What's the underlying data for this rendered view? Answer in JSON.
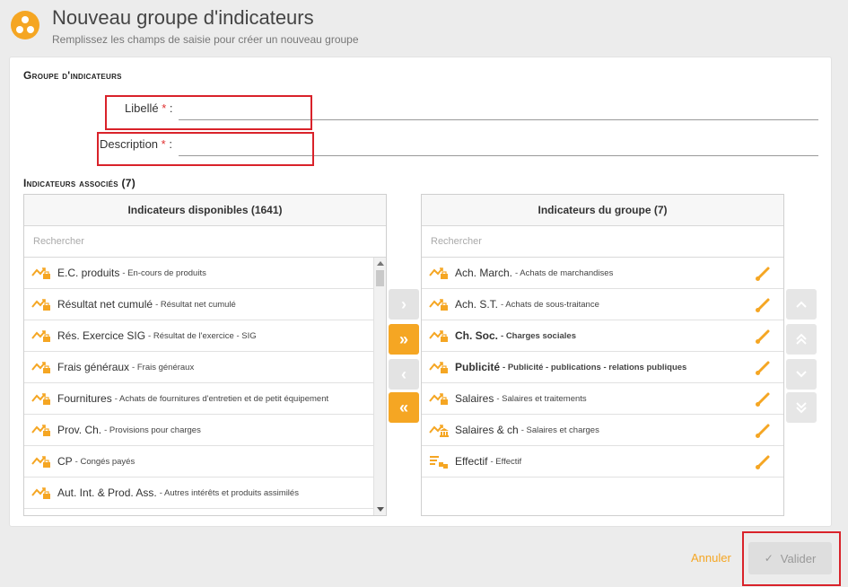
{
  "header": {
    "title": "Nouveau groupe d'indicateurs",
    "subtitle": "Remplissez les champs de saisie pour créer un nouveau groupe",
    "icon": "group-dots-icon"
  },
  "group_section": {
    "title": "Groupe d'indicateurs",
    "label_field": {
      "label": "Libellé",
      "required_mark": "*",
      "separator": ":",
      "value": ""
    },
    "description_field": {
      "label": "Description",
      "required_mark": "*",
      "separator": ":",
      "value": ""
    }
  },
  "associated_section": {
    "title": "Indicateurs associés (7)"
  },
  "available_list": {
    "header": "Indicateurs disponibles (1641)",
    "search_placeholder": "Rechercher",
    "items": [
      {
        "name": "E.C. produits",
        "desc": "- En-cours de produits",
        "icon": "trend-indicator-icon"
      },
      {
        "name": "Résultat net cumulé",
        "desc": "- Résultat net cumulé",
        "icon": "trend-indicator-icon"
      },
      {
        "name": "Rés. Exercice SIG",
        "desc": "- Résultat de l'exercice - SIG",
        "icon": "trend-indicator-icon"
      },
      {
        "name": "Frais généraux",
        "desc": "- Frais généraux",
        "icon": "trend-indicator-icon"
      },
      {
        "name": "Fournitures",
        "desc": "- Achats de fournitures d'entretien et de petit équipement",
        "icon": "trend-indicator-icon"
      },
      {
        "name": "Prov. Ch.",
        "desc": "- Provisions pour charges",
        "icon": "trend-indicator-icon"
      },
      {
        "name": "CP",
        "desc": "- Congés payés",
        "icon": "trend-indicator-icon"
      },
      {
        "name": "Aut. Int. & Prod. Ass.",
        "desc": "- Autres intérêts et produits assimilés",
        "icon": "trend-indicator-icon"
      }
    ]
  },
  "group_list": {
    "header": "Indicateurs du groupe (7)",
    "search_placeholder": "Rechercher",
    "items": [
      {
        "name": "Ach. March.",
        "desc": "- Achats de marchandises",
        "icon": "trend-indicator-icon"
      },
      {
        "name": "Ach. S.T.",
        "desc": "- Achats de sous-traitance",
        "icon": "trend-indicator-icon"
      },
      {
        "name": "Ch. Soc.",
        "desc": "- Charges sociales",
        "icon": "trend-indicator-icon"
      },
      {
        "name": "Publicité",
        "desc": "- Publicité - publications - relations publiques",
        "icon": "trend-indicator-icon"
      },
      {
        "name": "Salaires",
        "desc": "- Salaires et traitements",
        "icon": "trend-indicator-icon"
      },
      {
        "name": "Salaires & ch",
        "desc": "- Salaires et charges",
        "icon": "trend-building-indicator-icon"
      },
      {
        "name": "Effectif",
        "desc": "- Effectif",
        "icon": "list-indicator-icon"
      }
    ]
  },
  "transfer_buttons": {
    "add_one": "›",
    "add_all": "»",
    "remove_one": "‹",
    "remove_all": "«"
  },
  "order_buttons": [
    "chevron-up-icon",
    "double-chevron-up-icon",
    "chevron-down-icon",
    "double-chevron-down-icon"
  ],
  "footer": {
    "cancel_label": "Annuler",
    "validate_label": "Valider"
  },
  "colors": {
    "accent": "#f5a623",
    "highlight_box": "#d9222a"
  }
}
